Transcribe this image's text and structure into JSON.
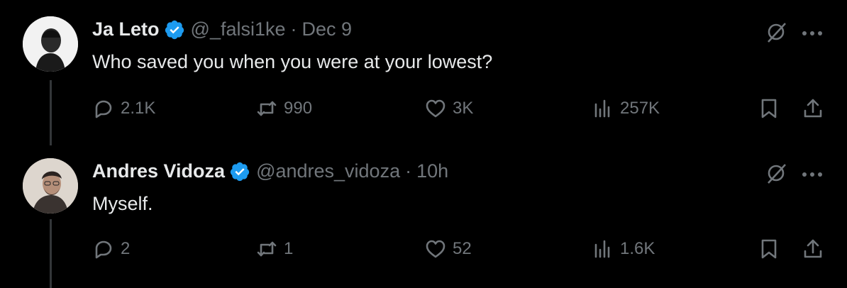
{
  "tweets": [
    {
      "author": "Ja Leto",
      "handle": "@_falsi1ke",
      "separator": "·",
      "time": "Dec 9",
      "text": "Who saved you when you were at your lowest?",
      "replies": "2.1K",
      "retweets": "990",
      "likes": "3K",
      "views": "257K"
    },
    {
      "author": "Andres Vidoza",
      "handle": "@andres_vidoza",
      "separator": "·",
      "time": "10h",
      "text": "Myself.",
      "replies": "2",
      "retweets": "1",
      "likes": "52",
      "views": "1.6K"
    }
  ],
  "colors": {
    "background": "#000000",
    "text": "#e7e9ea",
    "muted": "#71767b",
    "verified": "#1d9bf0"
  },
  "icons": [
    "verified-badge-icon",
    "grok-icon",
    "more-icon",
    "reply-icon",
    "retweet-icon",
    "like-icon",
    "views-icon",
    "bookmark-icon",
    "share-icon"
  ]
}
